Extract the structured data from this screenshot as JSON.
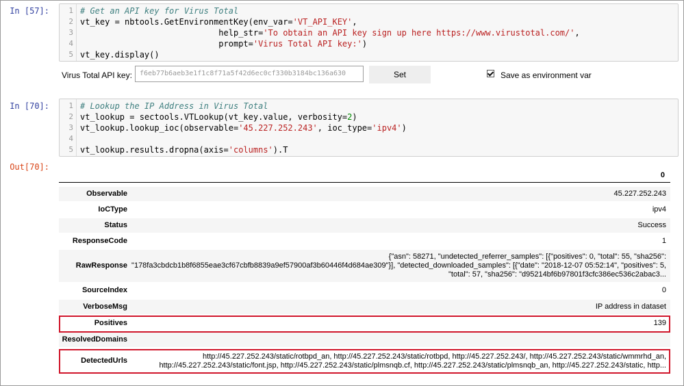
{
  "cells": [
    {
      "prompt": "In [57]:",
      "lines": [
        {
          "n": "1",
          "parts": [
            {
              "t": "# Get an API key for Virus Total",
              "c": "cm"
            }
          ]
        },
        {
          "n": "2",
          "parts": [
            {
              "t": "vt_key = nbtools.GetEnvironmentKey(env_var=",
              "c": ""
            },
            {
              "t": "'VT_API_KEY'",
              "c": "st"
            },
            {
              "t": ",",
              "c": ""
            }
          ]
        },
        {
          "n": "3",
          "parts": [
            {
              "t": "                            help_str=",
              "c": ""
            },
            {
              "t": "'To obtain an API key sign up here https://www.virustotal.com/'",
              "c": "st"
            },
            {
              "t": ",",
              "c": ""
            }
          ]
        },
        {
          "n": "4",
          "parts": [
            {
              "t": "                            prompt=",
              "c": ""
            },
            {
              "t": "'Virus Total API key:'",
              "c": "st"
            },
            {
              "t": ")",
              "c": ""
            }
          ]
        },
        {
          "n": "5",
          "parts": [
            {
              "t": "vt_key.display()",
              "c": ""
            }
          ]
        }
      ]
    },
    {
      "prompt": "In [70]:",
      "lines": [
        {
          "n": "1",
          "parts": [
            {
              "t": "# Lookup the IP Address in Virus Total",
              "c": "cm"
            }
          ]
        },
        {
          "n": "2",
          "parts": [
            {
              "t": "vt_lookup = sectools.VTLookup(vt_key.value, verbosity=",
              "c": ""
            },
            {
              "t": "2",
              "c": "nm"
            },
            {
              "t": ")",
              "c": ""
            }
          ]
        },
        {
          "n": "3",
          "parts": [
            {
              "t": "vt_lookup.lookup_ioc(observable=",
              "c": ""
            },
            {
              "t": "'45.227.252.243'",
              "c": "st"
            },
            {
              "t": ", ioc_type=",
              "c": ""
            },
            {
              "t": "'ipv4'",
              "c": "st"
            },
            {
              "t": ")",
              "c": ""
            }
          ]
        },
        {
          "n": "4",
          "parts": []
        },
        {
          "n": "5",
          "parts": [
            {
              "t": "vt_lookup.results.dropna(axis=",
              "c": ""
            },
            {
              "t": "'columns'",
              "c": "st"
            },
            {
              "t": ").T",
              "c": ""
            }
          ]
        }
      ]
    }
  ],
  "widget": {
    "label": "Virus Total API key:",
    "value": "f6eb77b6aeb3e1f1c8f71a5f42d6ec0cf330b3184bc136a630",
    "set_button": "Set",
    "checkbox_label": "Save as environment var",
    "checked": true
  },
  "output": {
    "prompt": "Out[70]:",
    "column_header": "0",
    "rows": [
      {
        "key": "Observable",
        "value": "45.227.252.243"
      },
      {
        "key": "IoCType",
        "value": "ipv4"
      },
      {
        "key": "Status",
        "value": "Success"
      },
      {
        "key": "ResponseCode",
        "value": "1"
      },
      {
        "key": "RawResponse",
        "lines": [
          "{\"asn\": 58271, \"undetected_referrer_samples\": [{\"positives\": 0, \"total\": 55, \"sha256\":",
          "\"178fa3cbdcb1b8f6855eae3cf67cbfb8839a9ef57900af3b60446f4d684ae309\"}], \"detected_downloaded_samples\": [{\"date\": \"2018-12-07 05:52:14\", \"positives\": 5,",
          "\"total\": 57, \"sha256\": \"d95214bf6b97801f3cfc386ec536c2abac3..."
        ]
      },
      {
        "key": "SourceIndex",
        "value": "0"
      },
      {
        "key": "VerboseMsg",
        "value": "IP address in dataset"
      },
      {
        "key": "Positives",
        "value": "139"
      },
      {
        "key": "ResolvedDomains",
        "value": ""
      },
      {
        "key": "DetectedUrls",
        "lines": [
          "http://45.227.252.243/static/rotbpd_an, http://45.227.252.243/static/rotbpd, http://45.227.252.243/, http://45.227.252.243/static/wmmrhd_an,",
          "http://45.227.252.243/static/font.jsp, http://45.227.252.243/static/plmsnqb.cf, http://45.227.252.243/static/plmsnqb_an, http://45.227.252.243/static, http..."
        ]
      }
    ]
  },
  "highlight_color": "#d0152a"
}
